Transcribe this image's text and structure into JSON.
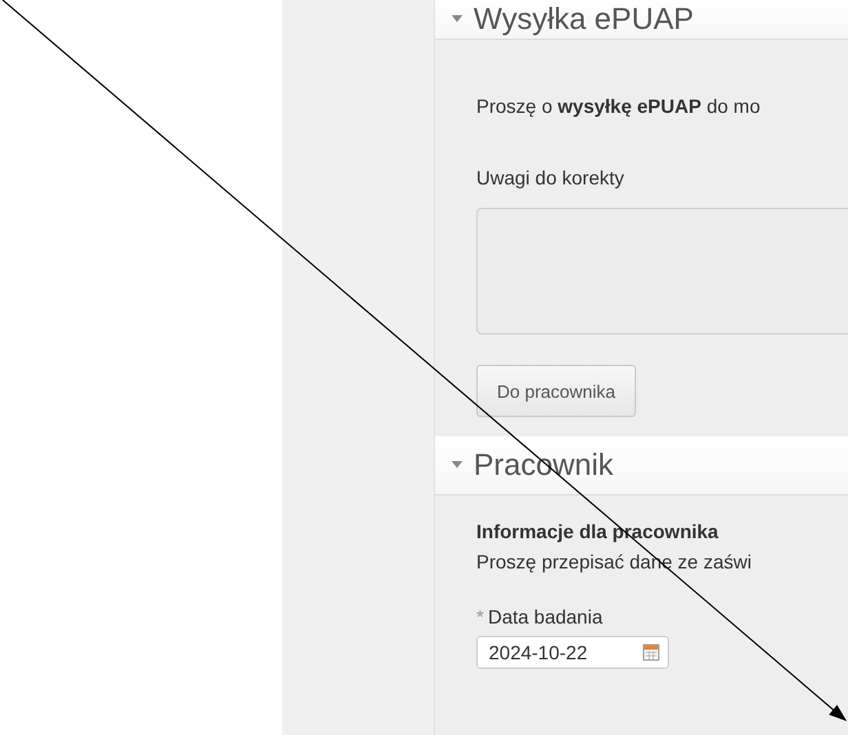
{
  "epuap_section": {
    "title": "Wysyłka ePUAP",
    "expanded": true,
    "message": "Proszę o **wysyłkę ePUAP** do mo",
    "remarks_label": "Uwagi do korekty",
    "button": "Do pracownika"
  },
  "employee_section": {
    "title": "Pracownik",
    "expanded": true,
    "info_title": "Informacje dla pracownika",
    "info_text": "Proszę przepisać dane ze zaświ",
    "required_mark": "*",
    "date_label": "Data badania",
    "date_value": "2024-10-22"
  }
}
